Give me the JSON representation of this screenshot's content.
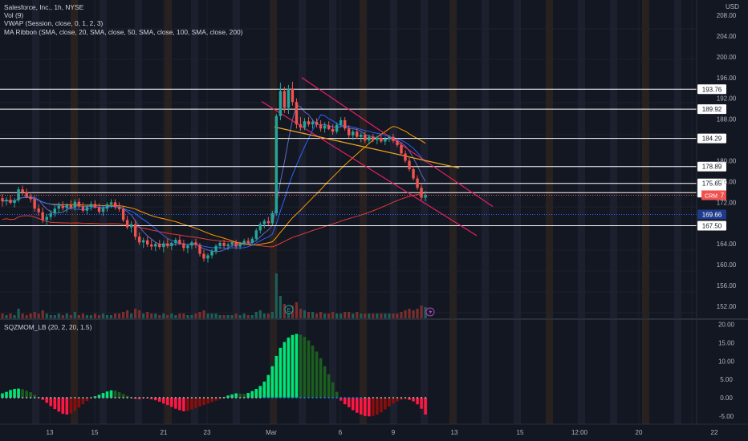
{
  "legend": {
    "title": "Salesforce, Inc., 1h, NYSE",
    "indicators": [
      "Vol (9)",
      "VWAP (Session, close, 0, 1, 2, 3)",
      "MA Ribbon (SMA, close, 20, SMA, close, 50, SMA, close, 100, SMA, close, 200)"
    ],
    "oscillator": "SQZMOM_LB (20, 2, 20, 1.5)"
  },
  "currency": "USD",
  "colors": {
    "background": "#131722",
    "up": "#26a69a",
    "down": "#ef5350",
    "channel": "#e91e63",
    "trendline": "#f5a623",
    "level_line": "#ffffff",
    "vwap": "#2962ff",
    "ma_orange": "#ff9800",
    "ma_red": "#e53935",
    "sqz_up_strong": "#00e676",
    "sqz_up_weak": "#1b5e20",
    "sqz_down_strong": "#ff1744",
    "sqz_down_weak": "#880e0e"
  },
  "icons": [
    "earnings-marker-icon",
    "dividend-flash-icon"
  ],
  "chart_data": {
    "type": "candlestick",
    "symbol": "CRM",
    "last_price": "173.37",
    "ylim": [
      150.0,
      210.0
    ],
    "price_ticks": [
      "208.00",
      "204.00",
      "200.00",
      "196.00",
      "192.00",
      "188.00",
      "180.00",
      "176.00",
      "172.00",
      "164.00",
      "160.00",
      "156.00",
      "152.00"
    ],
    "level_labels": [
      "193.76",
      "189.92",
      "184.29",
      "178.89",
      "175.65",
      "173.86",
      "169.66",
      "167.50"
    ],
    "x_ticks": [
      "13",
      "15",
      "21",
      "23",
      "Mar",
      "6",
      "9",
      "13",
      "15",
      "12:00",
      "20",
      "22"
    ],
    "candles": [
      [
        172.8,
        173.6,
        171.2,
        172.2
      ],
      [
        172.2,
        173.0,
        171.4,
        172.5
      ],
      [
        172.5,
        173.4,
        171.6,
        171.9
      ],
      [
        171.9,
        172.8,
        171.0,
        172.4
      ],
      [
        172.4,
        175.0,
        172.0,
        174.5
      ],
      [
        174.5,
        175.2,
        173.4,
        173.9
      ],
      [
        173.9,
        174.6,
        172.8,
        173.1
      ],
      [
        173.1,
        174.0,
        172.0,
        172.6
      ],
      [
        172.6,
        173.2,
        170.2,
        170.8
      ],
      [
        170.8,
        171.6,
        169.4,
        170.1
      ],
      [
        170.1,
        171.0,
        168.0,
        168.6
      ],
      [
        168.6,
        169.8,
        167.5,
        169.2
      ],
      [
        169.2,
        170.5,
        168.6,
        169.9
      ],
      [
        169.9,
        171.4,
        169.2,
        170.8
      ],
      [
        170.8,
        172.0,
        170.0,
        171.3
      ],
      [
        171.3,
        172.2,
        170.4,
        170.9
      ],
      [
        170.9,
        171.8,
        170.0,
        171.5
      ],
      [
        171.5,
        172.4,
        170.6,
        171.0
      ],
      [
        171.0,
        172.6,
        170.4,
        172.1
      ],
      [
        172.1,
        172.8,
        170.8,
        171.2
      ],
      [
        171.2,
        172.0,
        170.0,
        170.4
      ],
      [
        170.4,
        171.6,
        169.6,
        171.1
      ],
      [
        171.1,
        172.2,
        170.4,
        171.7
      ],
      [
        171.7,
        172.4,
        170.8,
        171.0
      ],
      [
        171.0,
        171.8,
        169.8,
        170.2
      ],
      [
        170.2,
        171.4,
        169.4,
        170.8
      ],
      [
        170.8,
        172.0,
        170.2,
        171.6
      ],
      [
        171.6,
        172.6,
        170.9,
        172.0
      ],
      [
        172.0,
        172.6,
        170.6,
        171.1
      ],
      [
        171.1,
        172.0,
        170.2,
        170.7
      ],
      [
        170.7,
        171.2,
        168.2,
        168.6
      ],
      [
        168.6,
        169.4,
        166.8,
        167.2
      ],
      [
        167.2,
        168.4,
        166.2,
        167.8
      ],
      [
        167.8,
        168.6,
        164.8,
        165.4
      ],
      [
        165.4,
        166.2,
        163.8,
        164.3
      ],
      [
        164.3,
        165.2,
        163.2,
        164.7
      ],
      [
        164.7,
        165.4,
        163.4,
        163.9
      ],
      [
        163.9,
        164.8,
        162.8,
        163.5
      ],
      [
        163.5,
        164.4,
        162.6,
        164.0
      ],
      [
        164.0,
        164.8,
        163.0,
        163.4
      ],
      [
        163.4,
        164.6,
        162.4,
        164.1
      ],
      [
        164.1,
        165.0,
        163.2,
        163.6
      ],
      [
        163.6,
        164.4,
        162.8,
        164.2
      ],
      [
        164.2,
        165.2,
        163.6,
        164.8
      ],
      [
        164.8,
        165.6,
        163.8,
        164.1
      ],
      [
        164.1,
        164.8,
        162.6,
        163.2
      ],
      [
        163.2,
        164.0,
        162.2,
        163.7
      ],
      [
        163.7,
        164.6,
        163.0,
        164.3
      ],
      [
        164.3,
        165.0,
        163.2,
        163.8
      ],
      [
        163.8,
        164.2,
        161.6,
        162.1
      ],
      [
        162.1,
        162.8,
        160.6,
        161.2
      ],
      [
        161.2,
        162.2,
        160.4,
        161.8
      ],
      [
        161.8,
        163.0,
        161.2,
        162.6
      ],
      [
        162.6,
        164.0,
        162.0,
        163.6
      ],
      [
        163.6,
        164.6,
        163.0,
        164.2
      ],
      [
        164.2,
        164.8,
        163.2,
        163.6
      ],
      [
        163.6,
        164.2,
        162.8,
        163.9
      ],
      [
        163.9,
        164.6,
        163.4,
        164.3
      ],
      [
        164.3,
        164.8,
        163.0,
        163.5
      ],
      [
        163.5,
        164.4,
        163.0,
        164.0
      ],
      [
        164.0,
        165.0,
        163.6,
        164.6
      ],
      [
        164.6,
        165.2,
        163.8,
        164.2
      ],
      [
        164.2,
        165.4,
        163.9,
        165.0
      ],
      [
        165.0,
        167.0,
        164.6,
        166.6
      ],
      [
        166.6,
        168.2,
        166.0,
        167.8
      ],
      [
        167.8,
        168.8,
        167.0,
        168.4
      ],
      [
        168.4,
        169.2,
        167.6,
        168.0
      ],
      [
        168.0,
        170.4,
        167.6,
        169.9
      ],
      [
        169.9,
        189.0,
        169.4,
        188.6
      ],
      [
        188.6,
        195.0,
        187.8,
        193.4
      ],
      [
        193.4,
        194.2,
        189.2,
        190.2
      ],
      [
        190.2,
        194.6,
        189.0,
        193.9
      ],
      [
        193.9,
        195.2,
        190.6,
        191.3
      ],
      [
        191.3,
        192.0,
        186.2,
        187.0
      ],
      [
        187.0,
        188.4,
        185.8,
        186.4
      ],
      [
        186.4,
        188.2,
        185.9,
        187.6
      ],
      [
        187.6,
        188.4,
        186.6,
        187.0
      ],
      [
        187.0,
        188.0,
        186.2,
        187.5
      ],
      [
        187.5,
        188.2,
        186.4,
        186.9
      ],
      [
        186.9,
        187.8,
        185.6,
        186.2
      ],
      [
        186.2,
        187.4,
        185.4,
        186.8
      ],
      [
        186.8,
        187.6,
        185.9,
        186.1
      ],
      [
        186.1,
        187.0,
        185.0,
        185.6
      ],
      [
        185.6,
        187.4,
        185.2,
        186.9
      ],
      [
        186.9,
        188.4,
        186.4,
        187.8
      ],
      [
        187.8,
        188.4,
        185.8,
        186.2
      ],
      [
        186.2,
        186.8,
        184.4,
        184.9
      ],
      [
        184.9,
        186.0,
        184.0,
        185.6
      ],
      [
        185.6,
        186.2,
        184.2,
        184.6
      ],
      [
        184.6,
        185.4,
        183.6,
        185.0
      ],
      [
        185.0,
        185.6,
        183.4,
        183.9
      ],
      [
        183.9,
        185.0,
        183.2,
        184.6
      ],
      [
        184.6,
        185.2,
        183.6,
        184.0
      ],
      [
        184.0,
        184.8,
        183.2,
        184.4
      ],
      [
        184.4,
        185.0,
        183.4,
        183.7
      ],
      [
        183.7,
        184.6,
        183.0,
        184.2
      ],
      [
        184.2,
        185.0,
        183.6,
        184.6
      ],
      [
        184.6,
        185.2,
        183.4,
        183.8
      ],
      [
        183.8,
        184.4,
        182.6,
        183.0
      ],
      [
        183.0,
        183.6,
        181.0,
        181.4
      ],
      [
        181.4,
        182.0,
        179.6,
        180.0
      ],
      [
        180.0,
        180.8,
        178.0,
        178.4
      ],
      [
        178.4,
        179.0,
        176.2,
        176.6
      ],
      [
        176.6,
        177.2,
        174.4,
        174.8
      ],
      [
        174.8,
        175.4,
        172.4,
        172.9
      ],
      [
        172.9,
        174.2,
        172.2,
        173.37
      ]
    ],
    "volume": [
      3,
      2,
      3,
      2,
      6,
      3,
      2,
      3,
      4,
      3,
      5,
      3,
      2,
      2,
      3,
      2,
      3,
      2,
      4,
      2,
      3,
      2,
      2,
      3,
      2,
      3,
      2,
      2,
      3,
      3,
      4,
      5,
      3,
      6,
      5,
      3,
      4,
      3,
      3,
      2,
      3,
      2,
      3,
      2,
      3,
      3,
      2,
      2,
      3,
      4,
      5,
      3,
      3,
      3,
      2,
      2,
      2,
      2,
      3,
      2,
      3,
      2,
      2,
      4,
      5,
      3,
      3,
      4,
      28,
      14,
      9,
      7,
      8,
      10,
      6,
      5,
      4,
      4,
      3,
      4,
      3,
      3,
      4,
      3,
      3,
      4,
      4,
      3,
      4,
      3,
      3,
      3,
      3,
      3,
      3,
      3,
      3,
      3,
      3,
      4,
      5,
      6,
      5,
      6,
      8,
      7
    ],
    "squeeze_momentum": [
      1.2,
      1.6,
      2.1,
      2.4,
      2.5,
      2.3,
      1.9,
      1.5,
      0.8,
      0.2,
      -0.6,
      -1.4,
      -2.3,
      -3.1,
      -3.8,
      -4.4,
      -4.6,
      -4.3,
      -3.6,
      -2.7,
      -1.8,
      -0.9,
      -0.2,
      0.4,
      0.8,
      1.3,
      1.7,
      2.0,
      1.9,
      1.5,
      1.0,
      0.5,
      0.1,
      -0.3,
      -0.4,
      -0.3,
      -0.2,
      -0.4,
      -0.7,
      -1.1,
      -1.6,
      -2.0,
      -2.5,
      -3.0,
      -3.4,
      -3.7,
      -3.6,
      -3.2,
      -2.8,
      -2.4,
      -2.0,
      -1.6,
      -1.2,
      -0.8,
      -0.4,
      0.2,
      0.6,
      0.9,
      1.2,
      1.1,
      1.0,
      1.3,
      1.8,
      2.4,
      3.2,
      4.4,
      6.2,
      8.6,
      11.4,
      13.6,
      15.2,
      16.4,
      17.1,
      17.4,
      17.2,
      16.6,
      15.6,
      14.2,
      12.6,
      10.8,
      8.6,
      6.4,
      4.2,
      1.6,
      -0.8,
      -1.8,
      -2.6,
      -3.4,
      -4.1,
      -4.6,
      -5.0,
      -5.1,
      -5.0,
      -4.6,
      -4.0,
      -3.2,
      -2.4,
      -1.6,
      -1.0,
      -0.6,
      -0.4,
      -0.6,
      -1.0,
      -1.8,
      -3.0,
      -4.6
    ],
    "osc_ylim": [
      -7.0,
      21.0
    ],
    "osc_ticks": [
      "20.00",
      "15.00",
      "10.00",
      "5.00",
      "0.00",
      "-5.00"
    ]
  }
}
